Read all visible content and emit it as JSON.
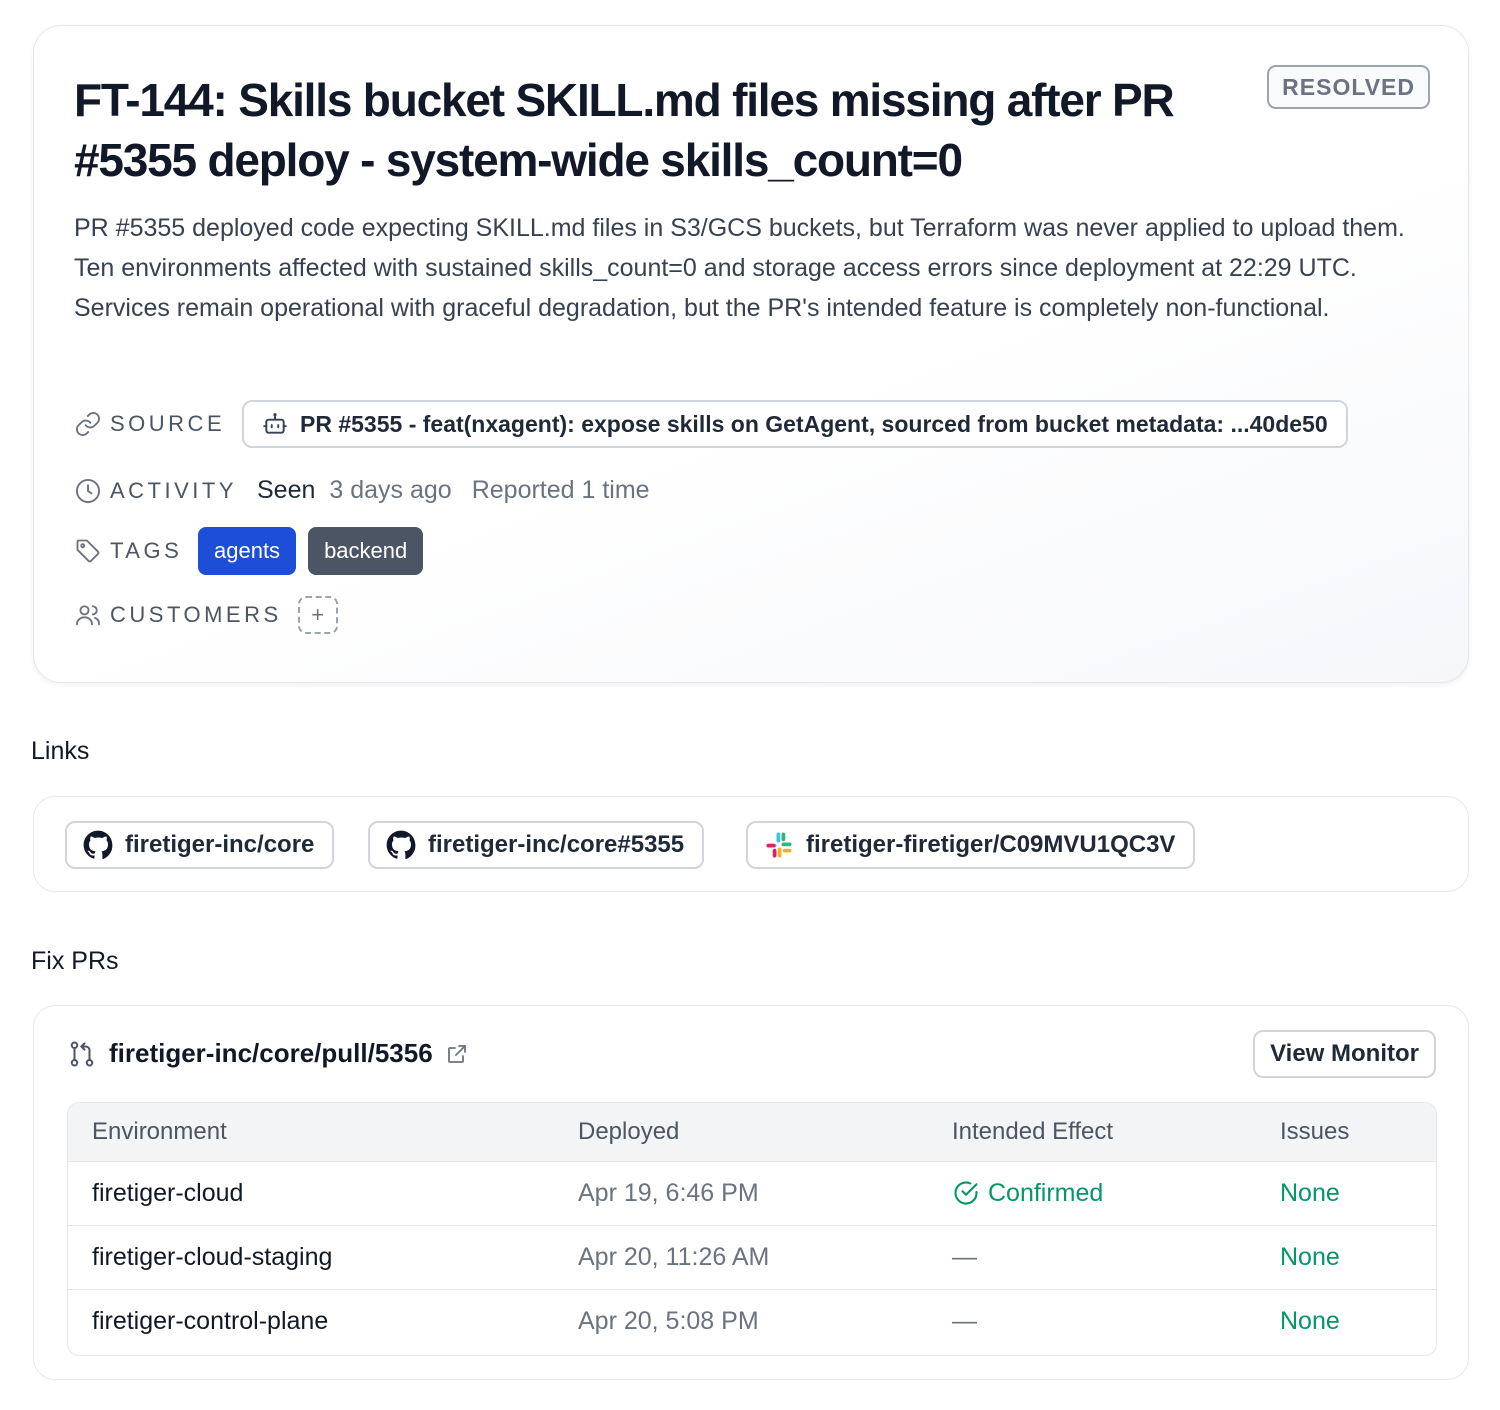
{
  "issue": {
    "title": "FT-144: Skills bucket SKILL.md files missing after PR #5355 deploy - system-wide skills_count=0",
    "status": "RESOLVED",
    "description": "PR #5355 deployed code expecting SKILL.md files in S3/GCS buckets, but Terraform was never applied to upload them. Ten environments affected with sustained skills_count=0 and storage access errors since deployment at 22:29 UTC. Services remain operational with graceful degradation, but the PR's intended feature is completely non-functional.",
    "source": {
      "label": "SOURCE",
      "icon": "robot-icon",
      "value": "PR #5355 - feat(nxagent): expose skills on GetAgent, sourced from bucket metadata: ...40de50"
    },
    "activity": {
      "label": "ACTIVITY",
      "seen_label": "Seen",
      "seen_ago": "3 days ago",
      "reported": "Reported 1 time"
    },
    "tags": {
      "label": "TAGS",
      "items": [
        {
          "label": "agents",
          "color": "#1d4ed8"
        },
        {
          "label": "backend",
          "color": "#4b5563"
        }
      ]
    },
    "customers": {
      "label": "CUSTOMERS",
      "add_label": "+"
    }
  },
  "links": {
    "title": "Links",
    "items": [
      {
        "label": "firetiger-inc/core",
        "icon": "github-icon"
      },
      {
        "label": "firetiger-inc/core#5355",
        "icon": "github-icon"
      },
      {
        "label": "firetiger-firetiger/C09MVU1QC3V",
        "icon": "slack-icon"
      }
    ]
  },
  "fix_prs": {
    "title": "Fix PRs",
    "pr_link": "firetiger-inc/core/pull/5356",
    "view_monitor": "View Monitor",
    "columns": [
      "Environment",
      "Deployed",
      "Intended Effect",
      "Issues"
    ],
    "rows": [
      {
        "environment": "firetiger-cloud",
        "deployed": "Apr 19, 6:46 PM",
        "effect": "Confirmed",
        "issues": "None"
      },
      {
        "environment": "firetiger-cloud-staging",
        "deployed": "Apr 20, 11:26 AM",
        "effect": "—",
        "issues": "None"
      },
      {
        "environment": "firetiger-control-plane",
        "deployed": "Apr 20, 5:08 PM",
        "effect": "—",
        "issues": "None"
      }
    ]
  },
  "colors": {
    "success": "#059669",
    "tag_agents": "#1d4ed8",
    "tag_backend": "#4b5563"
  }
}
